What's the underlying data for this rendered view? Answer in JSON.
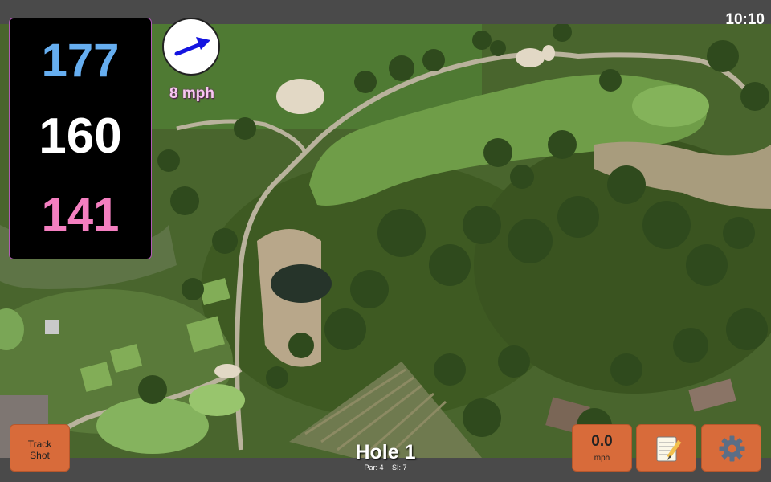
{
  "status": {
    "time": "10:10"
  },
  "distances": {
    "back": "177",
    "middle": "160",
    "front": "141"
  },
  "wind": {
    "speed": "8 mph",
    "icon": "wind-direction-arrow-icon"
  },
  "hole": {
    "title": "Hole 1",
    "par": "Par: 4",
    "stroke_index": "SI: 7"
  },
  "buttons": {
    "track_line1": "Track",
    "track_line2": "Shot",
    "speed_value": "0.0",
    "speed_unit": "mph",
    "notes_icon": "notepad-icon",
    "settings_icon": "gear-icon"
  },
  "colors": {
    "back": "#66aef0",
    "middle": "#ffffff",
    "front": "#f47fc0",
    "button": "#d86b3a",
    "wind_arrow": "#1414e0",
    "panel_border": "#b05bb5"
  }
}
